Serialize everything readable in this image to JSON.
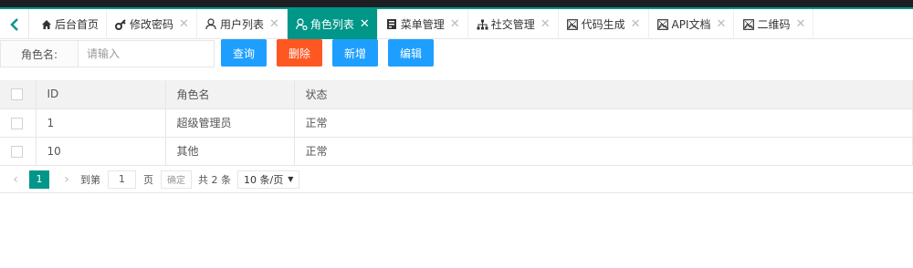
{
  "colors": {
    "accent": "#009688",
    "query": "#1e9fff",
    "delete": "#ff5722",
    "add": "#1e9fff",
    "edit": "#1e9fff"
  },
  "tabs": [
    {
      "label": "后台首页",
      "icon": "home-icon",
      "closable": false,
      "active": false
    },
    {
      "label": "修改密码",
      "icon": "key-icon",
      "closable": true,
      "active": false
    },
    {
      "label": "用户列表",
      "icon": "user-icon",
      "closable": true,
      "active": false
    },
    {
      "label": "角色列表",
      "icon": "user-role-icon",
      "closable": true,
      "active": true
    },
    {
      "label": "菜单管理",
      "icon": "server-icon",
      "closable": true,
      "active": false
    },
    {
      "label": "社交管理",
      "icon": "sitemap-icon",
      "closable": true,
      "active": false
    },
    {
      "label": "代码生成",
      "icon": "image-icon",
      "closable": true,
      "active": false
    },
    {
      "label": "API文档",
      "icon": "image-icon",
      "closable": true,
      "active": false
    },
    {
      "label": "二维码",
      "icon": "image-icon",
      "closable": true,
      "active": false
    }
  ],
  "search": {
    "label": "角色名:",
    "placeholder": "请输入",
    "query_label": "查询",
    "delete_label": "删除",
    "add_label": "新增",
    "edit_label": "编辑"
  },
  "table": {
    "columns": [
      "ID",
      "角色名",
      "状态"
    ],
    "rows": [
      {
        "id": "1",
        "name": "超级管理员",
        "status": "正常"
      },
      {
        "id": "10",
        "name": "其他",
        "status": "正常"
      }
    ]
  },
  "pagination": {
    "current_page": "1",
    "goto_prefix": "到第",
    "goto_value": "1",
    "goto_suffix": "页",
    "confirm_label": "确定",
    "total_text": "共 2 条",
    "page_size": "10 条/页"
  }
}
